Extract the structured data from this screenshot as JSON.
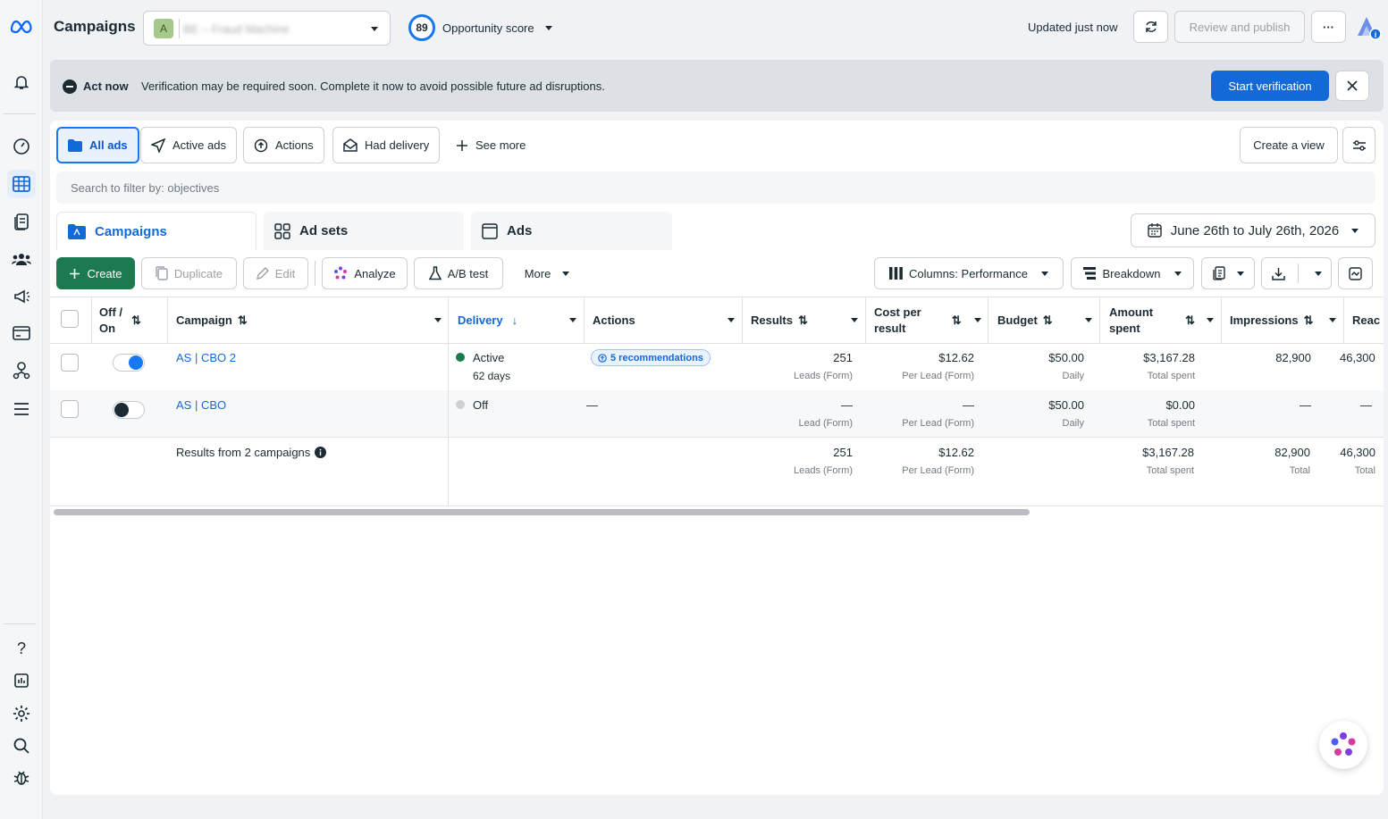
{
  "header": {
    "title": "Campaigns",
    "account_initial": "A",
    "account_name": "BE – Fraud Machine",
    "opportunity_score": "89",
    "opportunity_label": "Opportunity score",
    "updated": "Updated just now",
    "review_publish": "Review and publish",
    "more": "···"
  },
  "banner": {
    "heading": "Act now",
    "message": "Verification may be required soon. Complete it now to avoid possible future ad disruptions.",
    "cta": "Start verification"
  },
  "filters": {
    "items": [
      "All ads",
      "Active ads",
      "Actions",
      "Had delivery"
    ],
    "see_more": "See more",
    "create_view": "Create a view"
  },
  "search": {
    "placeholder": "Search to filter by: objectives"
  },
  "tabs": [
    "Campaigns",
    "Ad sets",
    "Ads"
  ],
  "date_range": "June 26th to July 26th, 2026",
  "toolbar": {
    "create": "Create",
    "duplicate": "Duplicate",
    "edit": "Edit",
    "analyze": "Analyze",
    "ab_test": "A/B test",
    "more": "More",
    "columns": "Columns: Performance",
    "breakdown": "Breakdown"
  },
  "table": {
    "headers": {
      "onoff_1": "Off /",
      "onoff_2": "On",
      "campaign": "Campaign",
      "delivery": "Delivery",
      "actions": "Actions",
      "results": "Results",
      "cpr_1": "Cost per",
      "cpr_2": "result",
      "budget": "Budget",
      "spent_1": "Amount",
      "spent_2": "spent",
      "impressions": "Impressions",
      "reach": "Reac"
    },
    "rows": [
      {
        "on": true,
        "campaign": "AS | CBO 2",
        "delivery": "Active",
        "delivery_sub": "62 days",
        "actions": "5 recommendations",
        "results": "251",
        "results_sub": "Leads (Form)",
        "cpr": "$12.62",
        "cpr_sub": "Per Lead (Form)",
        "budget": "$50.00",
        "budget_sub": "Daily",
        "spent": "$3,167.28",
        "spent_sub": "Total spent",
        "impressions": "82,900",
        "reach": "46,300"
      },
      {
        "on": false,
        "campaign": "AS | CBO",
        "delivery": "Off",
        "actions": "—",
        "results": "—",
        "results_sub": "Lead (Form)",
        "cpr": "—",
        "cpr_sub": "Per Lead (Form)",
        "budget": "$50.00",
        "budget_sub": "Daily",
        "spent": "$0.00",
        "spent_sub": "Total spent",
        "impressions": "—",
        "reach": "—"
      }
    ],
    "summary": {
      "label": "Results from 2 campaigns",
      "results": "251",
      "results_sub": "Leads (Form)",
      "cpr": "$12.62",
      "cpr_sub": "Per Lead (Form)",
      "spent": "$3,167.28",
      "spent_sub": "Total spent",
      "impressions": "82,900",
      "impressions_sub": "Total",
      "reach": "46,300",
      "reach_sub": "Total"
    }
  },
  "colors": {
    "accent": "#1877f2",
    "create_green": "#1d7a4f",
    "active_dot": "#1d7a4f"
  }
}
